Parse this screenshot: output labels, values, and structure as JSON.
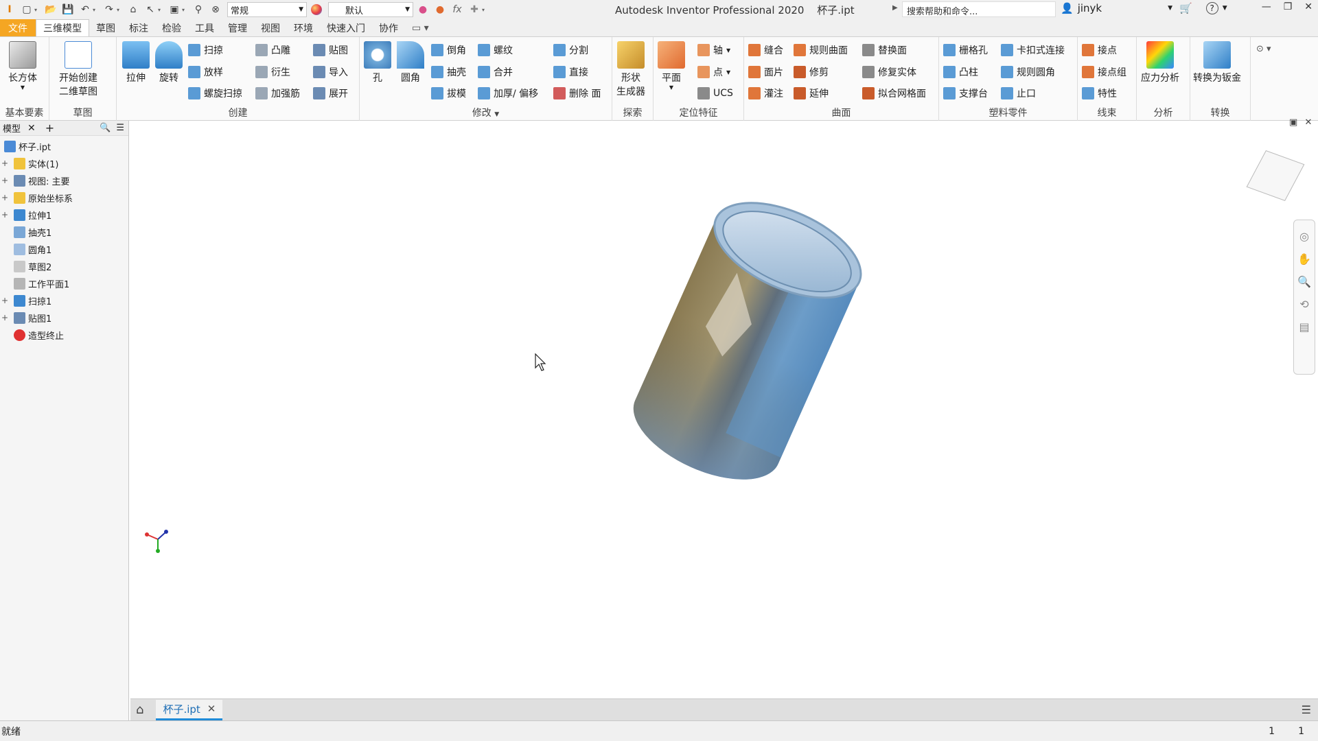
{
  "titlebar": {
    "style_select": "常规",
    "appearance_select": "默认",
    "app_title": "Autodesk Inventor Professional 2020",
    "doc_title": "杯子.ipt",
    "help_search_placeholder": "搜索帮助和命令...",
    "user": "jinyk"
  },
  "ribbon_tabs": [
    "文件",
    "三维模型",
    "草图",
    "标注",
    "检验",
    "工具",
    "管理",
    "视图",
    "环境",
    "快速入门",
    "协作"
  ],
  "ribbon": {
    "basic": {
      "title": "基本要素",
      "box": "长方体"
    },
    "sketch": {
      "title": "草图",
      "start_line1": "开始创建",
      "start_line2": "二维草图"
    },
    "create": {
      "title": "创建",
      "extrude": "拉伸",
      "revolve": "旋转",
      "sweep": "扫掠",
      "loft": "放样",
      "coil": "螺旋扫掠",
      "emboss": "凸雕",
      "derive": "衍生",
      "rib": "加强筋",
      "decal": "贴图",
      "import": "导入",
      "unfold": "展开"
    },
    "modify": {
      "title": "修改",
      "hole": "孔",
      "fillet": "圆角",
      "chamfer": "倒角",
      "shell": "抽壳",
      "draft": "拔模",
      "thread": "螺纹",
      "combine": "合并",
      "thicken": "加厚/ 偏移",
      "split": "分割",
      "direct": "直接",
      "delete_face": "删除 面"
    },
    "explore": {
      "title": "探索",
      "shape_gen_line1": "形状",
      "shape_gen_line2": "生成器"
    },
    "work": {
      "title": "定位特征",
      "plane": "平面",
      "axis": "轴",
      "point": "点",
      "ucs": "UCS"
    },
    "surface": {
      "title": "曲面",
      "stitch": "缝合",
      "patch": "面片",
      "sculpt": "灌注",
      "ruled": "规则曲面",
      "trim": "修剪",
      "extend": "延伸",
      "replace": "替换面",
      "repair": "修复实体",
      "mesh": "拟合网格面"
    },
    "plastic": {
      "title": "塑料零件",
      "grill": "栅格孔",
      "boss": "凸柱",
      "rest": "支撑台",
      "snap": "卡扣式连接",
      "rule_fillet": "规则圆角",
      "lip": "止口"
    },
    "harness": {
      "title": "线束",
      "pin": "接点",
      "pin_group": "接点组",
      "props": "特性"
    },
    "analysis": {
      "title": "分析",
      "stress": "应力分析"
    },
    "convert": {
      "title": "转换",
      "to_sheet": "转换为钣金"
    }
  },
  "browser": {
    "tab_label": "模型",
    "nodes": [
      {
        "label": "杯子.ipt",
        "icon": "part-icon",
        "expandable": false,
        "indent": 0
      },
      {
        "label": "实体(1)",
        "icon": "solid-bodies-icon",
        "expandable": true,
        "indent": 1
      },
      {
        "label": "视图: 主要",
        "icon": "view-rep-icon",
        "expandable": true,
        "indent": 1
      },
      {
        "label": "原始坐标系",
        "icon": "origin-folder-icon",
        "expandable": true,
        "indent": 1
      },
      {
        "label": "拉伸1",
        "icon": "extrude-icon",
        "expandable": true,
        "indent": 1
      },
      {
        "label": "抽壳1",
        "icon": "shell-icon",
        "expandable": false,
        "indent": 1
      },
      {
        "label": "圆角1",
        "icon": "fillet-icon",
        "expandable": false,
        "indent": 1
      },
      {
        "label": "草图2",
        "icon": "sketch-icon",
        "expandable": false,
        "indent": 1
      },
      {
        "label": "工作平面1",
        "icon": "work-plane-icon",
        "expandable": false,
        "indent": 1
      },
      {
        "label": "扫掠1",
        "icon": "sweep-icon",
        "expandable": true,
        "indent": 1
      },
      {
        "label": "贴图1",
        "icon": "decal-icon",
        "expandable": true,
        "indent": 1
      },
      {
        "label": "造型终止",
        "icon": "end-of-part-icon",
        "expandable": false,
        "indent": 1
      }
    ]
  },
  "doc_tab": "杯子.ipt",
  "status": {
    "text": "就绪",
    "count1": "1",
    "count2": "1"
  },
  "colors": {
    "file_tab": "#f5a623",
    "accent": "#1f8bd8",
    "mug_body": "#8fb4d8"
  }
}
